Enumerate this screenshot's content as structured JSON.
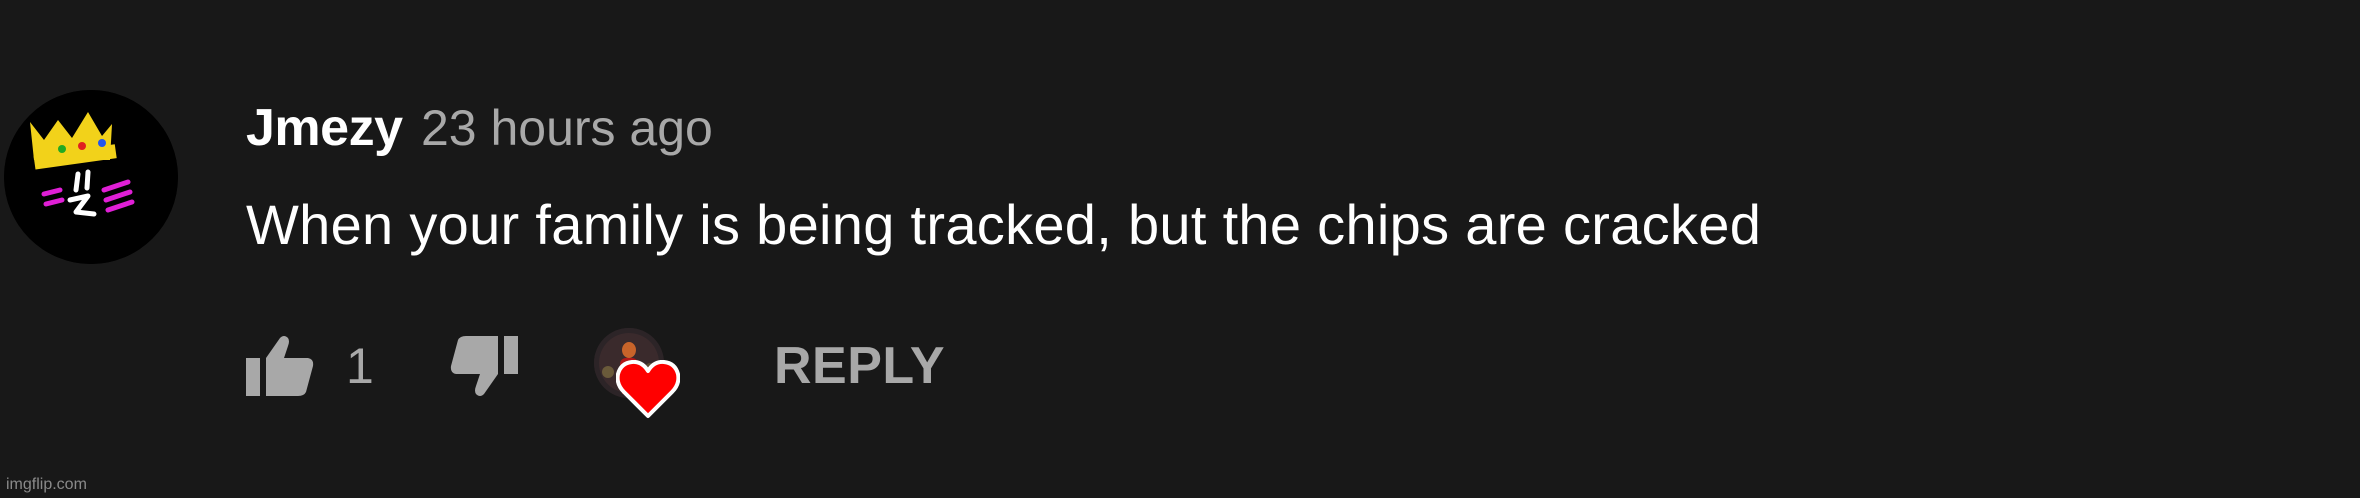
{
  "comment": {
    "author": "Jmezy",
    "timestamp": "23 hours ago",
    "text": "When your family is being tracked, but the chips are cracked",
    "avatar_icon": "crown-face-avatar",
    "like_count": "1",
    "reply_label": "REPLY",
    "heart_icon": "creator-heart-icon",
    "like_icon": "thumbs-up-icon",
    "dislike_icon": "thumbs-down-icon"
  },
  "watermark": "imgflip.com",
  "colors": {
    "background": "#181818",
    "primary_text": "#ffffff",
    "secondary_text": "#a8a8a8",
    "heart": "#ff0000"
  }
}
